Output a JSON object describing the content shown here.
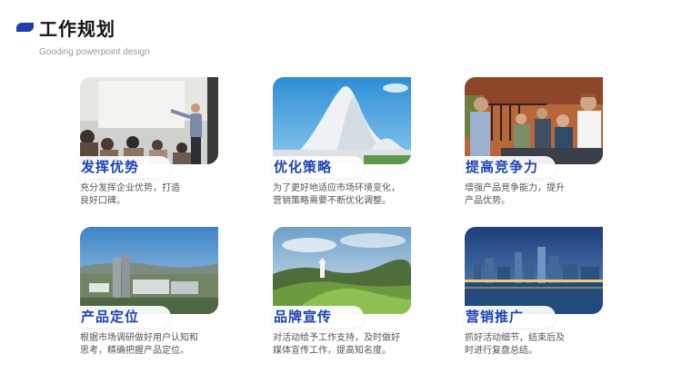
{
  "header": {
    "title": "工作规划",
    "subtitle": "Gooding powerpoint design"
  },
  "cards": [
    {
      "title": "发挥优势",
      "desc_lines": [
        "充分发挥企业优势，打造",
        "良好口碑。"
      ],
      "image": "presentation-photo"
    },
    {
      "title": "优化策略",
      "desc_lines": [
        "为了更好地适应市场环境变化，",
        "营销策略需要不断优化调整。"
      ],
      "image": "architecture-photo"
    },
    {
      "title": "提高竞争力",
      "desc_lines": [
        "增强产品竞争能力，提升",
        "产品优势。"
      ],
      "image": "students-photo"
    },
    {
      "title": "产品定位",
      "desc_lines": [
        "根据市场调研做好用户认知和",
        "思考，精确把握产品定位。"
      ],
      "image": "industrial-city-photo"
    },
    {
      "title": "品牌宣传",
      "desc_lines": [
        "对活动给予工作支持，及时做好",
        "媒体宣传工作，提高知名度。"
      ],
      "image": "hill-landscape-photo"
    },
    {
      "title": "营销推广",
      "desc_lines": [
        "抓好活动细节，结束后及",
        "时进行复盘总结。"
      ],
      "image": "city-night-photo"
    }
  ],
  "colors": {
    "accent": "#1e43b3",
    "title": "#151515",
    "subtitle": "#9a9a9a",
    "body_text": "#555555"
  }
}
